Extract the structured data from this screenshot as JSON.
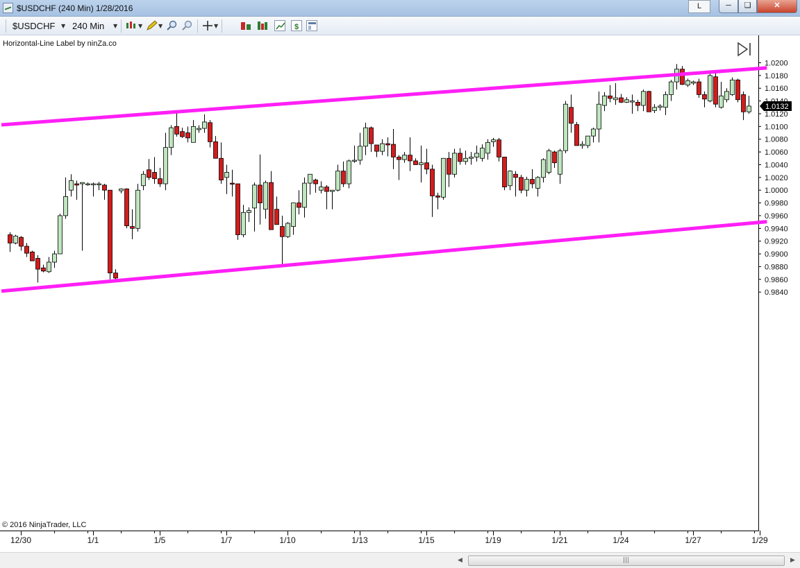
{
  "window": {
    "title": "$USDCHF (240 Min)  1/28/2016",
    "mode_button": "L",
    "minimize_icon": "minimize-icon",
    "maximize_icon": "maximize-icon",
    "close_icon": "close-icon"
  },
  "toolbar": {
    "instrument": "$USDCHF",
    "interval": "240 Min",
    "icons": [
      "candlestick-icon",
      "pencil-icon",
      "zoom-in-icon",
      "zoom-out-icon",
      "crosshair-icon",
      "strategy-icon",
      "indicators-icon",
      "data-series-icon",
      "dollar-icon",
      "properties-icon"
    ]
  },
  "chart": {
    "indicator_label": "Horizontal-Line Label by ninZa.co",
    "copyright": "© 2016 NinjaTrader, LLC",
    "last_price_label": "1.0132",
    "colors": {
      "up": "#bfe6bf",
      "down": "#d21c1c",
      "channel": "#ff1ff6",
      "price_tag": "#000000"
    }
  },
  "chart_data": {
    "type": "candlestick",
    "instrument": "$USDCHF",
    "interval": "240 Min",
    "y_range": [
      0.9833,
      1.0218
    ],
    "y_ticks": [
      "1.0200",
      "1.0180",
      "1.0160",
      "1.0140",
      "1.0120",
      "1.0100",
      "1.0080",
      "1.0060",
      "1.0040",
      "1.0020",
      "1.0000",
      "0.9980",
      "0.9960",
      "0.9940",
      "0.9920",
      "0.9900",
      "0.9880",
      "0.9860",
      "0.9840"
    ],
    "x_tick_labels": [
      {
        "label": "12/30",
        "bar": 2
      },
      {
        "label": "1/1",
        "bar": 15
      },
      {
        "label": "1/5",
        "bar": 27
      },
      {
        "label": "1/7",
        "bar": 39
      },
      {
        "label": "1/10",
        "bar": 50
      },
      {
        "label": "1/13",
        "bar": 63
      },
      {
        "label": "1/15",
        "bar": 75
      },
      {
        "label": "1/19",
        "bar": 87
      },
      {
        "label": "1/21",
        "bar": 99
      },
      {
        "label": "1/24",
        "bar": 110
      },
      {
        "label": "1/27",
        "bar": 123
      },
      {
        "label": "1/29",
        "bar": 135
      }
    ],
    "candles": [
      [
        0.993,
        0.9934,
        0.9903,
        0.9917
      ],
      [
        0.9917,
        0.993,
        0.9915,
        0.9928
      ],
      [
        0.9926,
        0.9928,
        0.9905,
        0.9912
      ],
      [
        0.9912,
        0.9917,
        0.9895,
        0.9901
      ],
      [
        0.9903,
        0.9905,
        0.989,
        0.9889
      ],
      [
        0.9893,
        0.9898,
        0.9855,
        0.9876
      ],
      [
        0.9878,
        0.9883,
        0.9871,
        0.9873
      ],
      [
        0.9872,
        0.9895,
        0.987,
        0.9887
      ],
      [
        0.9887,
        0.9905,
        0.9878,
        0.99
      ],
      [
        0.99,
        0.9963,
        0.9915,
        0.996
      ],
      [
        0.996,
        1.002,
        0.9955,
        0.999
      ],
      [
        1.0,
        1.0025,
        0.999,
        1.0015
      ],
      [
        1.001,
        1.0015,
        0.9985,
        1.0008
      ],
      [
        1.001,
        1.0012,
        0.9905,
        1.0012
      ],
      [
        1.001,
        1.0012,
        1.0007,
        1.001
      ],
      [
        1.001,
        1.0012,
        0.999,
        1.001
      ],
      [
        1.001,
        1.0013,
        1.0,
        1.001
      ],
      [
        1.0008,
        1.001,
        0.9985,
        1.0
      ],
      [
        1.0,
        1.0,
        0.986,
        0.987
      ],
      [
        0.987,
        0.9876,
        0.986,
        0.9862
      ],
      [
        0.9999,
        1.0003,
        0.9995,
        1.0002
      ],
      [
        1.0002,
        1.0003,
        0.994,
        0.9944
      ],
      [
        0.9943,
        0.997,
        0.9923,
        0.994
      ],
      [
        0.994,
        1.001,
        0.9935,
        1.0
      ],
      [
        1.0007,
        1.003,
        1.0,
        1.0025
      ],
      [
        1.0032,
        1.0049,
        1.0016,
        1.002
      ],
      [
        1.0028,
        1.0052,
        1.001,
        1.0018
      ],
      [
        1.0018,
        1.0035,
        1.0005,
        1.001
      ],
      [
        1.001,
        1.009,
        1.0,
        1.0067
      ],
      [
        1.0067,
        1.0102,
        1.0055,
        1.0098
      ],
      [
        1.01,
        1.0122,
        1.0084,
        1.0088
      ],
      [
        1.0092,
        1.0098,
        1.0082,
        1.0084
      ],
      [
        1.009,
        1.01,
        1.0075,
        1.0082
      ],
      [
        1.0075,
        1.011,
        1.0075,
        1.01
      ],
      [
        1.0095,
        1.0102,
        1.009,
        1.0097
      ],
      [
        1.0097,
        1.0119,
        1.009,
        1.0107
      ],
      [
        1.0106,
        1.011,
        1.0067,
        1.0076
      ],
      [
        1.0076,
        1.0085,
        1.0058,
        1.005
      ],
      [
        1.005,
        1.0075,
        1.001,
        1.0016
      ],
      [
        1.002,
        1.004,
        0.9994,
        1.0028
      ],
      [
        1.0011,
        1.0032,
        0.999,
        1.001
      ],
      [
        1.001,
        1.001,
        0.9922,
        0.993
      ],
      [
        0.993,
        0.9977,
        0.9926,
        0.9965
      ],
      [
        0.9965,
        0.9973,
        0.995,
        0.9968
      ],
      [
        0.9972,
        1.0012,
        0.9935,
        1.0008
      ],
      [
        1.0008,
        1.0056,
        0.9946,
        0.998
      ],
      [
        0.997,
        1.0015,
        0.9955,
        1.0012
      ],
      [
        1.0012,
        1.003,
        0.994,
        0.9938
      ],
      [
        0.997,
        0.999,
        0.9963,
        0.9946
      ],
      [
        0.9943,
        0.996,
        0.9882,
        0.9927
      ],
      [
        0.9927,
        0.995,
        0.9925,
        0.9948
      ],
      [
        0.9943,
        0.998,
        0.993,
        0.998
      ],
      [
        0.998,
        1.0,
        0.9962,
        0.9973
      ],
      [
        0.9973,
        1.002,
        0.9957,
        1.0011
      ],
      [
        1.0011,
        1.002,
        0.9993,
        1.0025
      ],
      [
        1.0016,
        1.0018,
        0.9996,
        1.001
      ],
      [
        1.0,
        1.0014,
        0.9995,
        1.0005
      ],
      [
        1.0005,
        1.0008,
        0.997,
        0.9998
      ],
      [
        0.9998,
        1.0,
        0.997,
        1.0
      ],
      [
        1.0,
        1.004,
        0.9998,
        1.003
      ],
      [
        1.003,
        1.0045,
        1.0005,
        1.001
      ],
      [
        1.001,
        1.0048,
        1.0003,
        1.0046
      ],
      [
        1.0046,
        1.007,
        1.0043,
        1.0047
      ],
      [
        1.0047,
        1.009,
        1.004,
        1.0069
      ],
      [
        1.0069,
        1.0106,
        1.0055,
        1.0098
      ],
      [
        1.0098,
        1.01,
        1.006,
        1.0073
      ],
      [
        1.0071,
        1.0068,
        1.0052,
        1.0061
      ],
      [
        1.0061,
        1.008,
        1.0055,
        1.0073
      ],
      [
        1.0073,
        1.0083,
        1.0053,
        1.0071
      ],
      [
        1.0072,
        1.0096,
        1.0033,
        1.0052
      ],
      [
        1.0052,
        1.0055,
        1.0016,
        1.0048
      ],
      [
        1.0048,
        1.006,
        1.0043,
        1.0055
      ],
      [
        1.0055,
        1.0083,
        1.003,
        1.0046
      ],
      [
        1.0046,
        1.005,
        1.004,
        1.004
      ],
      [
        1.004,
        1.007,
        1.0012,
        1.0043
      ],
      [
        1.0043,
        1.0065,
        1.0025,
        1.0033
      ],
      [
        1.0033,
        1.004,
        0.9958,
        0.9991
      ],
      [
        0.9991,
        0.9996,
        0.997,
        0.9989
      ],
      [
        0.9989,
        1.005,
        0.9985,
        1.005
      ],
      [
        1.005,
        1.006,
        1.0005,
        1.0025
      ],
      [
        1.0025,
        1.0065,
        1.002,
        1.0058
      ],
      [
        1.0058,
        1.0066,
        1.004,
        1.0045
      ],
      [
        1.0045,
        1.0062,
        1.004,
        1.005
      ],
      [
        1.005,
        1.006,
        1.004,
        1.0052
      ],
      [
        1.0052,
        1.007,
        1.0045,
        1.0058
      ],
      [
        1.005,
        1.0072,
        1.0045,
        1.0066
      ],
      [
        1.0058,
        1.008,
        1.0048,
        1.0075
      ],
      [
        1.0076,
        1.0082,
        1.0068,
        1.0079
      ],
      [
        1.0079,
        1.0082,
        1.0045,
        1.0052
      ],
      [
        1.0052,
        1.0052,
        1.0,
        1.0005
      ],
      [
        1.0007,
        1.0031,
        1.0,
        1.003
      ],
      [
        1.0025,
        1.003,
        0.999,
        1.002
      ],
      [
        1.002,
        1.0024,
        0.9995,
        1.0
      ],
      [
        1.0,
        1.0021,
        0.999,
        1.0017
      ],
      [
        1.0017,
        1.0033,
        1.0003,
        1.001
      ],
      [
        1.0003,
        1.0022,
        0.999,
        1.002
      ],
      [
        1.002,
        1.005,
        1.0012,
        1.0048
      ],
      [
        1.0028,
        1.0065,
        1.0025,
        1.0062
      ],
      [
        1.006,
        1.0062,
        1.0035,
        1.0043
      ],
      [
        1.0025,
        1.0065,
        1.001,
        1.0062
      ],
      [
        1.0062,
        1.014,
        1.0058,
        1.0135
      ],
      [
        1.013,
        1.015,
        1.009,
        1.0105
      ],
      [
        1.0103,
        1.0107,
        1.007,
        1.007
      ],
      [
        1.007,
        1.0077,
        1.0065,
        1.0072
      ],
      [
        1.007,
        1.0082,
        1.0066,
        1.0085
      ],
      [
        1.0085,
        1.0098,
        1.0075,
        1.0096
      ],
      [
        1.0096,
        1.0155,
        1.0075,
        1.0135
      ],
      [
        1.0133,
        1.0154,
        1.0124,
        1.0148
      ],
      [
        1.0148,
        1.0165,
        1.0138,
        1.0144
      ],
      [
        1.0142,
        1.0168,
        1.0134,
        1.0145
      ],
      [
        1.0145,
        1.0151,
        1.0137,
        1.0138
      ],
      [
        1.0138,
        1.0146,
        1.0137,
        1.0142
      ],
      [
        1.014,
        1.015,
        1.012,
        1.014
      ],
      [
        1.0138,
        1.0142,
        1.0124,
        1.0133
      ],
      [
        1.0133,
        1.0158,
        1.0124,
        1.0155
      ],
      [
        1.0155,
        1.0156,
        1.0125,
        1.0123
      ],
      [
        1.0125,
        1.0135,
        1.0121,
        1.013
      ],
      [
        1.013,
        1.0135,
        1.0125,
        1.0132
      ],
      [
        1.013,
        1.0155,
        1.0118,
        1.015
      ],
      [
        1.015,
        1.0173,
        1.014,
        1.017
      ],
      [
        1.017,
        1.0198,
        1.0158,
        1.019
      ],
      [
        1.019,
        1.0195,
        1.0165,
        1.0166
      ],
      [
        1.0165,
        1.0175,
        1.0162,
        1.0172
      ],
      [
        1.0168,
        1.0172,
        1.0165,
        1.017
      ],
      [
        1.017,
        1.0175,
        1.0145,
        1.015
      ],
      [
        1.015,
        1.0155,
        1.013,
        1.0143
      ],
      [
        1.014,
        1.0185,
        1.0138,
        1.018
      ],
      [
        1.0178,
        1.0187,
        1.013,
        1.0135
      ],
      [
        1.013,
        1.017,
        1.0128,
        1.0148
      ],
      [
        1.0142,
        1.016,
        1.0138,
        1.0155
      ],
      [
        1.015,
        1.0177,
        1.0148,
        1.0173
      ],
      [
        1.0173,
        1.0175,
        1.0138,
        1.0142
      ],
      [
        1.015,
        1.0155,
        1.011,
        1.0123
      ],
      [
        1.0123,
        1.0148,
        1.012,
        1.0132
      ]
    ],
    "channel_lines": [
      {
        "name": "upper",
        "bar_start": -1.5,
        "price_start": 1.01025,
        "bar_end": 136.3,
        "price_end": 1.0192
      },
      {
        "name": "lower",
        "bar_start": -1.5,
        "price_start": 0.98415,
        "bar_end": 136.3,
        "price_end": 0.99505
      }
    ],
    "last_price": 1.0132
  }
}
